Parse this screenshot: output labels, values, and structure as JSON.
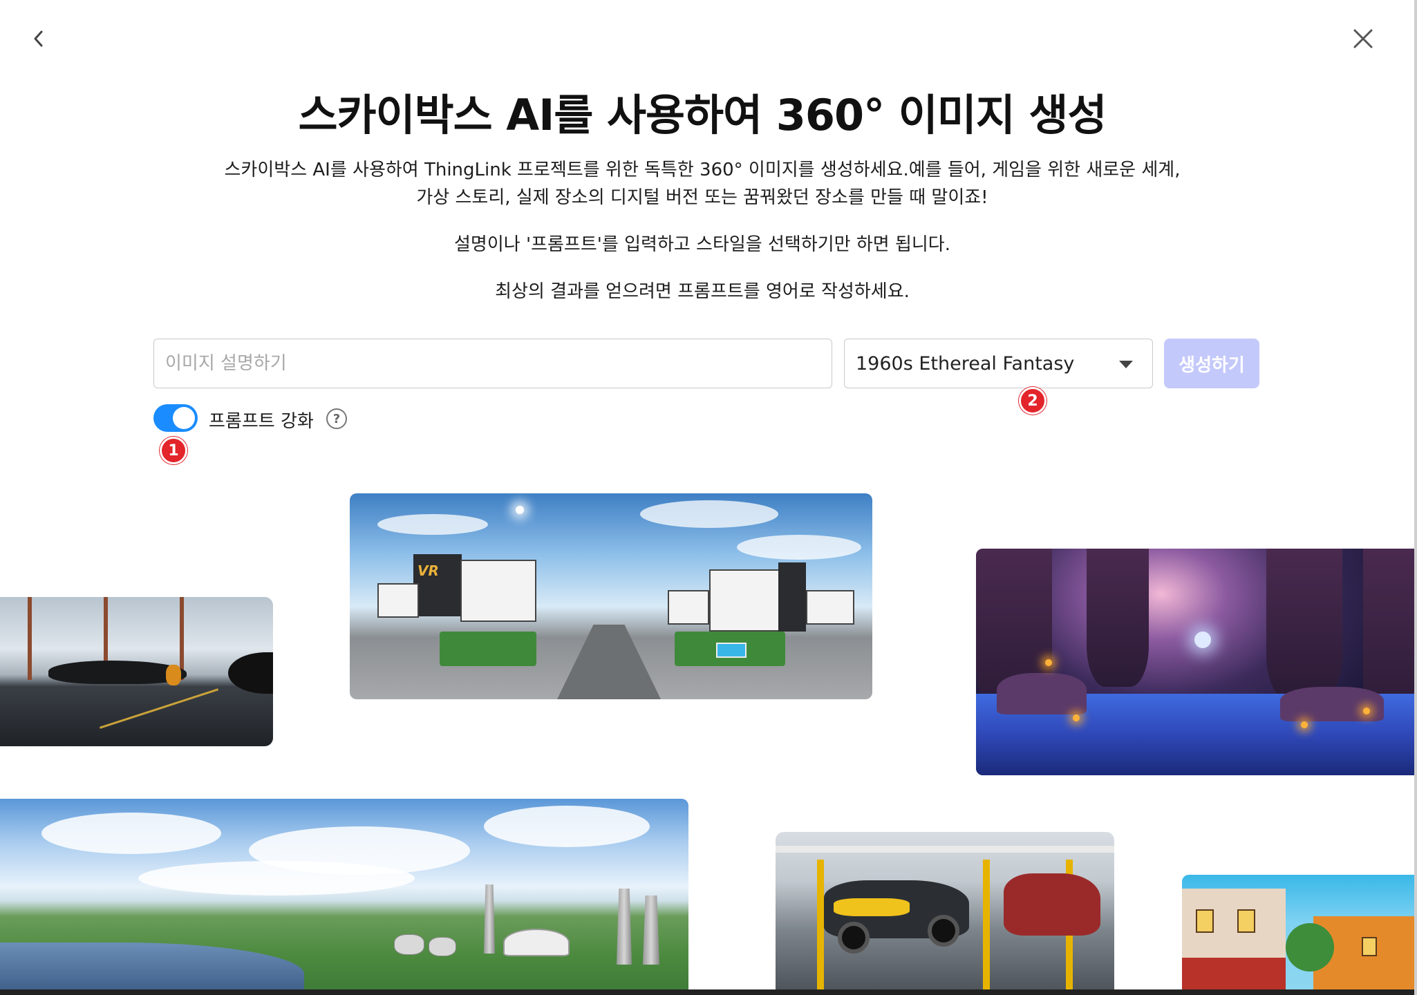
{
  "header": {
    "title": "스카이박스 AI를 사용하여 360° 이미지 생성",
    "back_icon": "chevron-left-icon",
    "close_icon": "close-icon"
  },
  "description": {
    "paragraph_1": "스카이박스 AI를 사용하여 ThingLink 프로젝트를 위한 독특한 360° 이미지를 생성하세요.예를 들어, 게임을 위한 새로운 세계, 가상 스토리, 실제 장소의 디지털 버전 또는 꿈꿔왔던 장소를 만들 때 말이죠!",
    "paragraph_2": "설명이나 '프롬프트'를 입력하고 스타일을 선택하기만 하면 됩니다.",
    "paragraph_3": "최상의 결과를 얻으려면 프롬프트를 영어로 작성하세요."
  },
  "form": {
    "prompt_placeholder": "이미지 설명하기",
    "prompt_value": "",
    "style_selected": "1960s Ethereal Fantasy",
    "generate_label": "생성하기",
    "enhance_label": "프롬프트 강화",
    "enhance_on": true,
    "help_glyph": "?"
  },
  "annotations": {
    "badge_1": "1",
    "badge_2": "2",
    "badge_color": "#e3242b"
  },
  "logo_text": "VR",
  "colors": {
    "accent": "#1a8cff",
    "generate_disabled": "#c4c9fb"
  }
}
